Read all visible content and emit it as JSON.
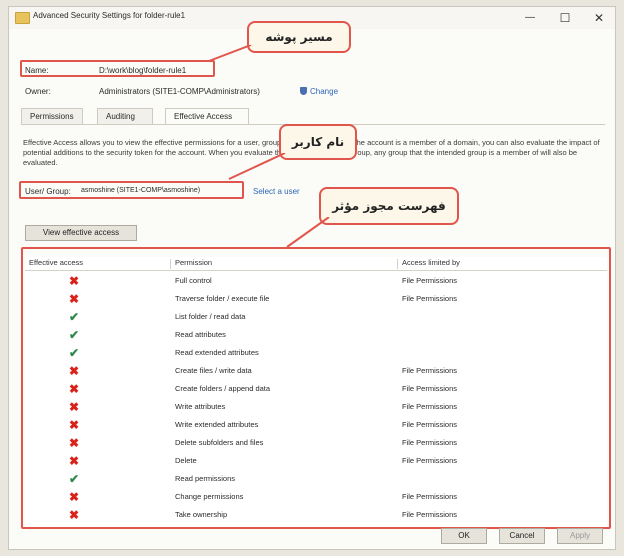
{
  "window": {
    "title": "Advanced Security Settings for folder-rule1",
    "minimize": "—",
    "maximize": "☐",
    "close": "✕"
  },
  "name_row": {
    "label": "Name:",
    "value": "D:\\work\\blog\\folder-rule1"
  },
  "owner_row": {
    "label": "Owner:",
    "value": "Administrators (SITE1-COMP\\Administrators)",
    "change_link": "Change"
  },
  "tabs": [
    {
      "label": "Permissions"
    },
    {
      "label": "Auditing"
    },
    {
      "label": "Effective Access"
    }
  ],
  "description": "Effective Access allows you to view the effective permissions for a user, group, or device account. If the account is a member of a domain, you can also evaluate the impact of potential additions to the security token for the account. When you evaluate the impact of adding a group, any group that the intended group is a member of will also be evaluated.",
  "user_group": {
    "label": "User/ Group:",
    "value": "asmoshine (SITE1-COMP\\asmoshine)",
    "select_link": "Select a user"
  },
  "view_button": "View effective access",
  "annotations": {
    "folder_path": "مسیر پوشه",
    "user_name": "نام کاربر",
    "effective_list": "فهرست مجوز مؤثر"
  },
  "table": {
    "headers": [
      "Effective access",
      "Permission",
      "Access limited by"
    ],
    "rows": [
      {
        "mark": "deny",
        "permission": "Full control",
        "limited": "File Permissions"
      },
      {
        "mark": "deny",
        "permission": "Traverse folder / execute file",
        "limited": "File Permissions"
      },
      {
        "mark": "allow",
        "permission": "List folder / read data",
        "limited": ""
      },
      {
        "mark": "allow",
        "permission": "Read attributes",
        "limited": ""
      },
      {
        "mark": "allow",
        "permission": "Read extended attributes",
        "limited": ""
      },
      {
        "mark": "deny",
        "permission": "Create files / write data",
        "limited": "File Permissions"
      },
      {
        "mark": "deny",
        "permission": "Create folders / append data",
        "limited": "File Permissions"
      },
      {
        "mark": "deny",
        "permission": "Write attributes",
        "limited": "File Permissions"
      },
      {
        "mark": "deny",
        "permission": "Write extended attributes",
        "limited": "File Permissions"
      },
      {
        "mark": "deny",
        "permission": "Delete subfolders and files",
        "limited": "File Permissions"
      },
      {
        "mark": "deny",
        "permission": "Delete",
        "limited": "File Permissions"
      },
      {
        "mark": "allow",
        "permission": "Read permissions",
        "limited": ""
      },
      {
        "mark": "deny",
        "permission": "Change permissions",
        "limited": "File Permissions"
      },
      {
        "mark": "deny",
        "permission": "Take ownership",
        "limited": "File Permissions"
      }
    ]
  },
  "footer": {
    "ok": "OK",
    "cancel": "Cancel",
    "apply": "Apply"
  },
  "colors": {
    "annotation_border": "#e0554c",
    "deny": "#d8231b",
    "allow": "#2f8a4c",
    "link": "#2d67b8"
  },
  "icons": {
    "deny": "red-x-icon",
    "allow": "green-check-icon",
    "owner_change": "shield-icon",
    "title": "folder-icon"
  }
}
